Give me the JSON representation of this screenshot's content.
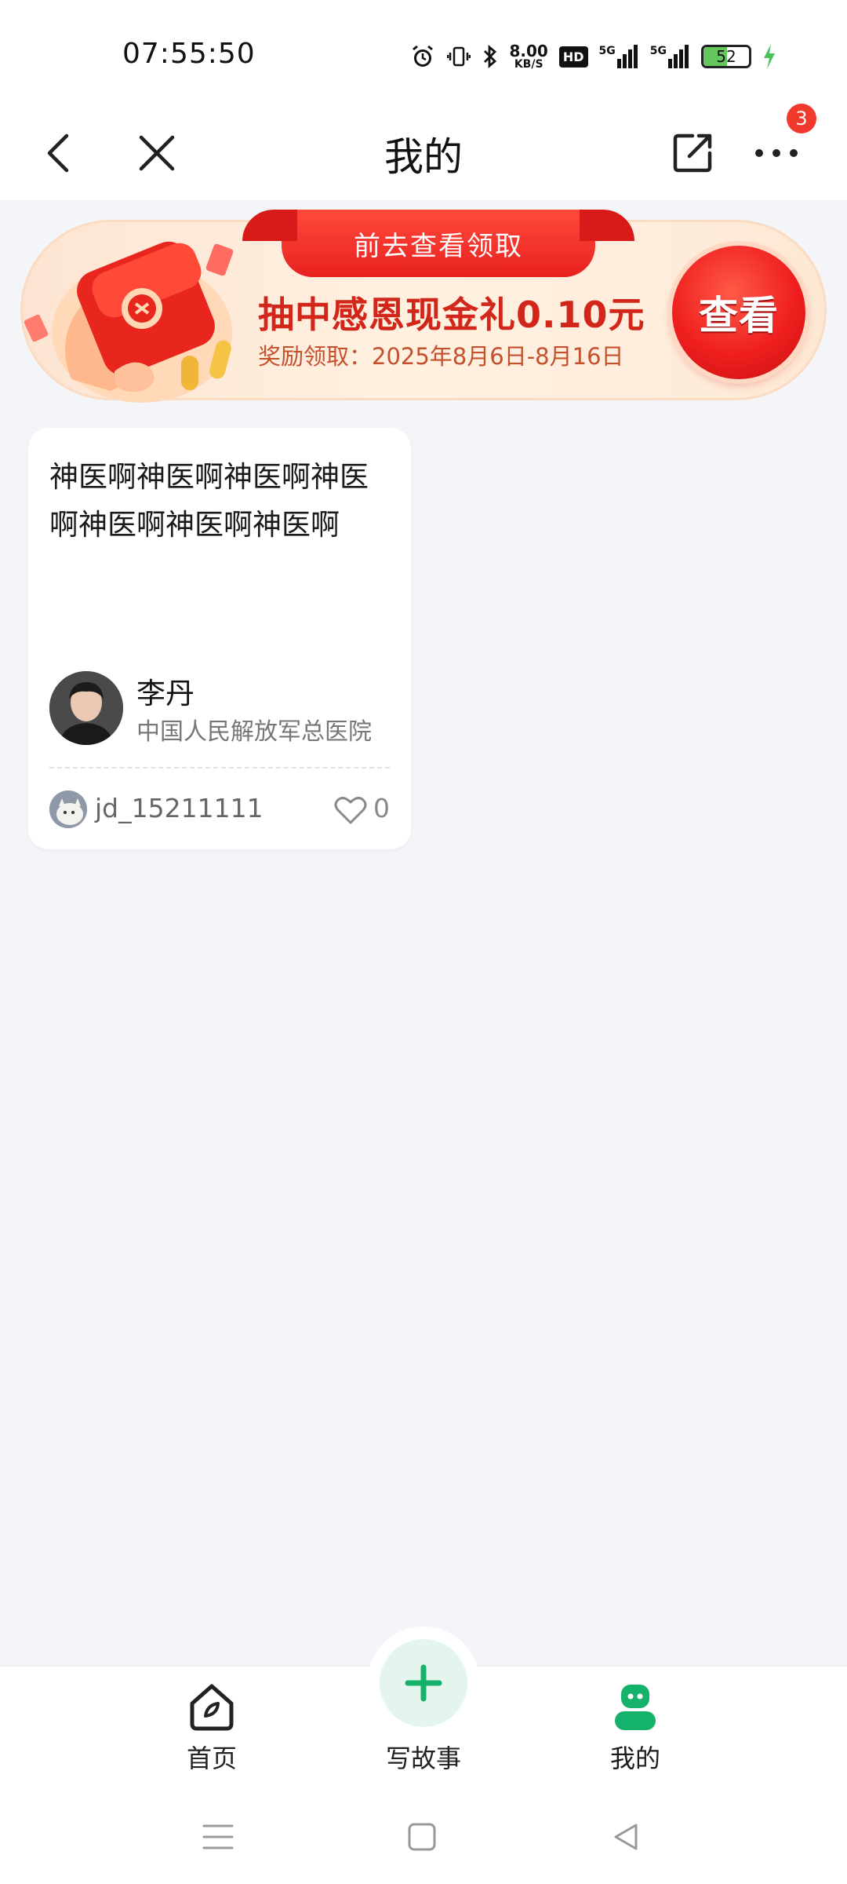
{
  "status_bar": {
    "time": "07:55:50",
    "net_speed_value": "8.00",
    "net_speed_unit": "KB/S",
    "hd_label": "HD",
    "signal1_label": "5G",
    "signal2_label": "5G",
    "battery_level": "52",
    "battery_fraction": 0.52
  },
  "header": {
    "title": "我的",
    "notification_count": "3"
  },
  "promo": {
    "tab_label": "前去查看领取",
    "title": "抽中感恩现金礼0.10元",
    "subtitle": "奖励领取：2025年8月6日-8月16日",
    "button_label": "查看"
  },
  "story_card": {
    "content": "神医啊神医啊神医啊神医啊神医啊神医啊神医啊",
    "doctor_name": "李丹",
    "hospital": "中国人民解放军总医院",
    "username": "jd_15211111",
    "likes": "0"
  },
  "bottom_nav": {
    "items": [
      {
        "label": "首页",
        "icon": "home-icon"
      },
      {
        "label": "写故事",
        "icon": "plus-icon"
      },
      {
        "label": "我的",
        "icon": "profile-icon"
      }
    ],
    "active": "我的"
  },
  "colors": {
    "accent_green": "#15b26b",
    "promo_red": "#d2261a",
    "badge_red": "#f03a2e"
  }
}
